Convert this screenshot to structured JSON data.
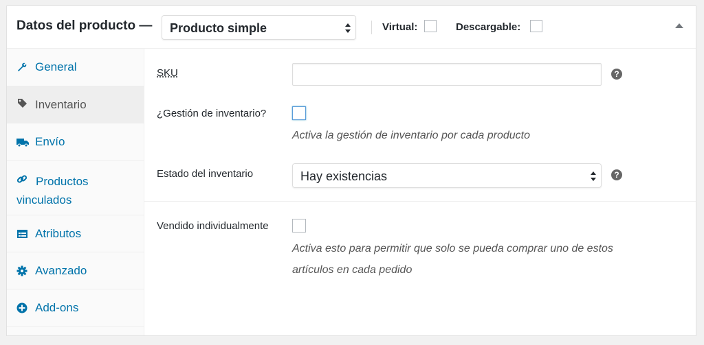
{
  "header": {
    "title": "Datos del producto —",
    "product_type_value": "Producto simple",
    "virtual_label": "Virtual:",
    "downloadable_label": "Descargable:"
  },
  "sidebar": {
    "items": [
      {
        "label": "General",
        "icon": "wrench-icon",
        "active": false
      },
      {
        "label": "Inventario",
        "icon": "tag-icon",
        "active": true
      },
      {
        "label": "Envío",
        "icon": "truck-icon",
        "active": false
      },
      {
        "label": "Productos vinculados",
        "icon": "link-icon",
        "active": false
      },
      {
        "label": "Atributos",
        "icon": "table-icon",
        "active": false
      },
      {
        "label": "Avanzado",
        "icon": "gear-icon",
        "active": false
      },
      {
        "label": "Add-ons",
        "icon": "plus-circle-icon",
        "active": false
      }
    ]
  },
  "inventory": {
    "sku_label": "SKU",
    "sku_value": "",
    "manage_stock_label": "¿Gestión de inventario?",
    "manage_stock_desc": "Activa la gestión de inventario por cada producto",
    "stock_status_label": "Estado del inventario",
    "stock_status_value": "Hay existencias",
    "sold_individually_label": "Vendido individualmente",
    "sold_individually_desc_line1": "Activa esto para permitir que solo se pueda comprar uno de estos",
    "sold_individually_desc_line2": "artículos en cada pedido",
    "help_glyph": "?"
  },
  "colors": {
    "link": "#0073aa",
    "active_tab_bg": "#eeeeee",
    "focus_checkbox": "#5b9dd9"
  }
}
